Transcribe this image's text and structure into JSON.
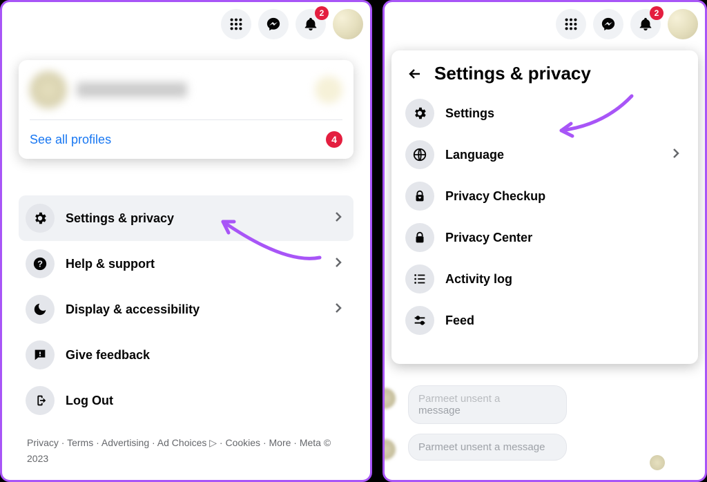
{
  "header": {
    "notif_badge": "2"
  },
  "left": {
    "see_all_profiles": "See all profiles",
    "profiles_badge": "4",
    "menu": [
      {
        "label": "Settings & privacy",
        "chev": true,
        "hover": true
      },
      {
        "label": "Help & support",
        "chev": true,
        "hover": false
      },
      {
        "label": "Display & accessibility",
        "chev": true,
        "hover": false
      },
      {
        "label": "Give feedback",
        "chev": false,
        "hover": false
      },
      {
        "label": "Log Out",
        "chev": false,
        "hover": false
      }
    ],
    "footer": "Privacy · Terms · Advertising · Ad Choices ▷ · Cookies · More · Meta © 2023"
  },
  "right": {
    "title": "Settings & privacy",
    "items": [
      {
        "label": "Settings",
        "chev": false
      },
      {
        "label": "Language",
        "chev": true
      },
      {
        "label": "Privacy Checkup",
        "chev": false
      },
      {
        "label": "Privacy Center",
        "chev": false
      },
      {
        "label": "Activity log",
        "chev": false
      },
      {
        "label": "Feed",
        "chev": false
      }
    ],
    "chat": {
      "msg1": "message",
      "msg2": "Parmeet unsent a message"
    }
  }
}
